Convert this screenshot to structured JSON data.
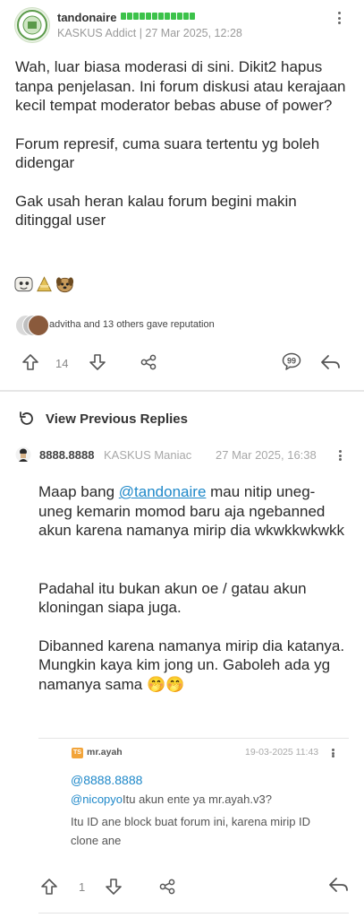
{
  "post": {
    "username": "tandonaire",
    "meta": "KASKUS Addict | 27 Mar 2025, 12:28",
    "paragraphs": [
      "Wah, luar biasa moderasi di sini. Dikit2 hapus tanpa penjelasan. Ini forum diskusi atau kerajaan kecil tempat moderator bebas abuse of power?",
      "Forum represif, cuma suara tertentu yg boleh didengar",
      "Gak usah heran kalau forum begini makin ditinggal user"
    ],
    "reputation_text": "advitha and 13 others gave reputation",
    "upvote_count": "14",
    "rep_bar_color": "#3cc24a"
  },
  "view_previous_replies": "View Previous Replies",
  "reply": {
    "username": "8888.8888",
    "rank": "KASKUS Maniac",
    "time": "27 Mar 2025, 16:38",
    "p1_before": "Maap bang ",
    "p1_mention": "@tandonaire",
    "p1_after": " mau nitip uneg-uneg kemarin momod baru aja ngebanned akun karena namanya mirip dia wkwkkwkwkk",
    "p2": "Padahal itu bukan akun oe / gatau akun kloningan siapa juga.",
    "p3": "Dibanned karena namanya mirip dia katanya. Mungkin kaya kim jong un. Gaboleh ada yg namanya sama",
    "p3_emoji": "🤭🤭",
    "upvote_count": "1"
  },
  "nested": {
    "badge": "TS",
    "username": "mr.ayah",
    "time": "19-03-2025 11:43",
    "line1": "@8888.8888",
    "line2_tag": "@nicopyo",
    "line2_rest": "Itu akun ente ya mr.ayah.v3?",
    "line3": "Itu ID ane block buat forum ini, karena mirip ID clone ane"
  },
  "colors": {
    "link": "#1e88c9",
    "accent_green": "#3cc24a",
    "ts_badge": "#f2a43a"
  }
}
